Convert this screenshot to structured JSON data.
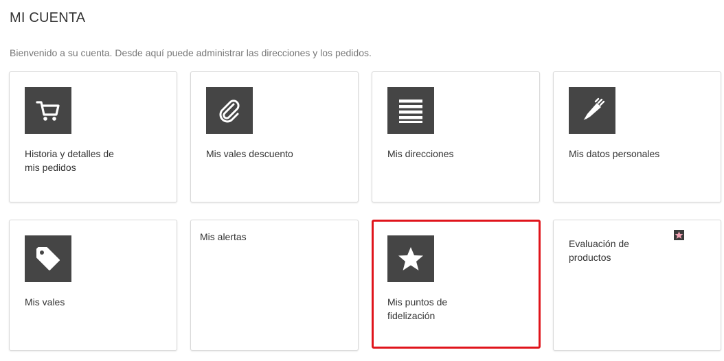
{
  "page": {
    "title": "MI CUENTA",
    "welcome": "Bienvenido a su cuenta. Desde aquí puede administrar las direcciones y los pedidos."
  },
  "tiles": [
    {
      "label": "Historia y detalles de mis pedidos",
      "icon": "cart-icon"
    },
    {
      "label": "Mis vales descuento",
      "icon": "paperclip-icon"
    },
    {
      "label": "Mis direcciones",
      "icon": "list-icon"
    },
    {
      "label": "Mis datos personales",
      "icon": "pen-icon"
    },
    {
      "label": "Mis vales",
      "icon": "tag-icon"
    },
    {
      "label": "Mis alertas",
      "icon": ""
    },
    {
      "label": "Mis puntos de fidelización",
      "icon": "star-icon"
    },
    {
      "label": "Evaluación de productos",
      "icon": "star-small-icon"
    }
  ],
  "colors": {
    "icon_bg": "#454545",
    "highlight_border": "#e0141b",
    "small_star": "#f2a2b3"
  }
}
